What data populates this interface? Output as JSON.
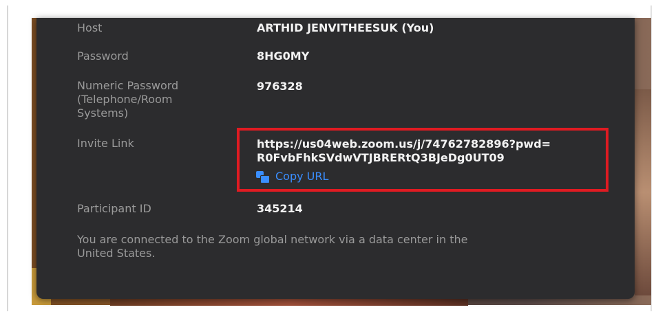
{
  "meeting_info": {
    "host_label": "Host",
    "host_value": "ARTHID JENVITHEESUK (You)",
    "password_label": "Password",
    "password_value": "8HG0MY",
    "numeric_password_label_line1": "Numeric Password",
    "numeric_password_label_line2": "(Telephone/Room",
    "numeric_password_label_line3": "Systems)",
    "numeric_password_value": "976328",
    "invite_link_label": "Invite Link",
    "invite_link_line1": "https://us04web.zoom.us/j/74762782896?pwd=",
    "invite_link_line2": "R0FvbFhkSVdwVTJBRERtQ3BJeDg0UT09",
    "copy_url_label": "Copy URL",
    "participant_id_label": "Participant ID",
    "participant_id_value": "345214",
    "network_note_line1": "You are connected to the Zoom global network via a data center in the",
    "network_note_line2": "United States."
  },
  "colors": {
    "panel_bg": "#2c2c2e",
    "label_text": "#9a9a9a",
    "value_text": "#f2f2f2",
    "link_accent": "#3a8eff",
    "highlight_border": "#e01b22"
  },
  "icons": {
    "copy": "copy-icon"
  }
}
